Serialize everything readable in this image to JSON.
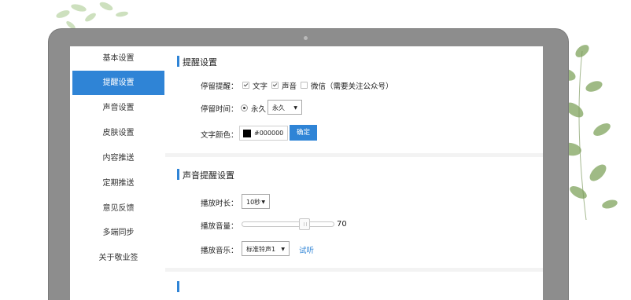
{
  "sidebar": {
    "items": [
      {
        "label": "基本设置",
        "active": false
      },
      {
        "label": "提醒设置",
        "active": true
      },
      {
        "label": "声音设置",
        "active": false
      },
      {
        "label": "皮肤设置",
        "active": false
      },
      {
        "label": "内容推送",
        "active": false
      },
      {
        "label": "定期推送",
        "active": false
      },
      {
        "label": "意见反馈",
        "active": false
      },
      {
        "label": "多端同步",
        "active": false
      },
      {
        "label": "关于敬业签",
        "active": false
      }
    ]
  },
  "reminder": {
    "title": "提醒设置",
    "stay_label": "停留提醒：",
    "opt_text": "文字",
    "opt_text_checked": true,
    "opt_sound": "声音",
    "opt_sound_checked": true,
    "opt_wechat": "微信（需要关注公众号）",
    "opt_wechat_checked": false,
    "time_label": "停留时间：",
    "radio_forever": "永久",
    "time_select": "永久",
    "color_label": "文字颜色：",
    "color_value": "#000000",
    "confirm": "确定"
  },
  "sound": {
    "title": "声音提醒设置",
    "duration_label": "播放时长：",
    "duration_value": "10秒",
    "volume_label": "播放音量：",
    "volume": 70,
    "volume_display": "70",
    "music_label": "播放音乐：",
    "music_value": "标准铃声1",
    "try_label": "试听"
  },
  "colors": {
    "accent": "#2f84d6",
    "laptop": "#8d8d8d"
  }
}
